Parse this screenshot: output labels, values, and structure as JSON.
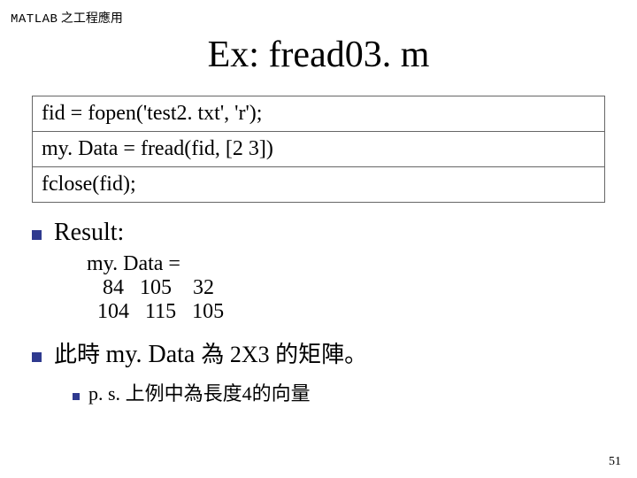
{
  "header": {
    "matlab": "MATLAB",
    "tail": "之工程應用"
  },
  "title": "Ex:  fread03. m",
  "code": {
    "l1": "fid = fopen('test2. txt', 'r');",
    "l2": "my. Data = fread(fid, [2 3])",
    "l3": "fclose(fid);"
  },
  "result": {
    "label": "Result:",
    "line0": "my. Data =",
    "line1": "   84   105    32",
    "line2": "  104   115   105"
  },
  "conclusion": {
    "pre": "此時 ",
    "latin": "my. Data ",
    "post": "為 2X3 的矩陣。"
  },
  "sub": {
    "ps": "p. s. ",
    "text": "上例中為長度4的向量"
  },
  "pagenum": "51"
}
